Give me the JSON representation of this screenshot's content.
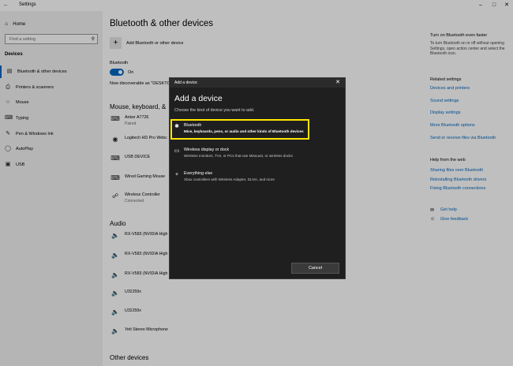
{
  "window": {
    "title": "Settings",
    "back_icon": "back-arrow-icon",
    "controls": [
      "minimize-icon",
      "maximize-icon",
      "close-icon"
    ]
  },
  "sidebar": {
    "home": "Home",
    "search_placeholder": "Find a setting",
    "section": "Devices",
    "items": [
      {
        "label": "Bluetooth & other devices",
        "icon": "bluetooth-devices-icon"
      },
      {
        "label": "Printers & scanners",
        "icon": "printer-icon"
      },
      {
        "label": "Mouse",
        "icon": "mouse-icon"
      },
      {
        "label": "Typing",
        "icon": "keyboard-icon"
      },
      {
        "label": "Pen & Windows Ink",
        "icon": "pen-icon"
      },
      {
        "label": "AutoPlay",
        "icon": "autoplay-icon"
      },
      {
        "label": "USB",
        "icon": "usb-icon"
      }
    ]
  },
  "main": {
    "title": "Bluetooth & other devices",
    "add_device": "Add Bluetooth or other device",
    "bluetooth_label": "Bluetooth",
    "toggle_state": "On",
    "discoverable": "Now discoverable as \"DESKTO",
    "section_mkp": "Mouse, keyboard, &",
    "devices": [
      {
        "name": "Anker A7726",
        "sub": "Paired",
        "icon": "keyboard-icon"
      },
      {
        "name": "Logitech HD Pro Webc",
        "sub": "",
        "icon": "webcam-icon"
      },
      {
        "name": "USB DEVICE",
        "sub": "",
        "icon": "keyboard-icon"
      },
      {
        "name": "Wired Gaming Mouse",
        "sub": "",
        "icon": "keyboard-icon"
      },
      {
        "name": "Wireless Controller",
        "sub": "Connected",
        "icon": "gamepad-icon"
      }
    ],
    "section_audio": "Audio",
    "audio": [
      {
        "name": "RX-V583 (NVIDIA High",
        "icon": "speaker-icon"
      },
      {
        "name": "RX-V583 (NVIDIA High",
        "icon": "speaker-icon"
      },
      {
        "name": "RX-V583 (NVIDIA High",
        "icon": "speaker-icon"
      },
      {
        "name": "U32J59x",
        "icon": "speaker-icon"
      },
      {
        "name": "U32J59x",
        "icon": "speaker-icon"
      },
      {
        "name": "Yeti Stereo Microphone",
        "icon": "speaker-icon"
      }
    ],
    "section_other": "Other devices"
  },
  "right": {
    "swift_title": "Turn on Bluetooth even faster",
    "swift_text": "To turn Bluetooth on or off without opening Settings, open action center and select the Bluetooth icon.",
    "related_title": "Related settings",
    "related_links": [
      "Devices and printers",
      "Sound settings",
      "Display settings",
      "More Bluetooth options",
      "Send or receive files via Bluetooth"
    ],
    "help_title": "Help from the web",
    "help_links": [
      "Sharing files over Bluetooth",
      "Reinstalling Bluetooth drivers",
      "Fixing Bluetooth connections"
    ],
    "get_help": "Get help",
    "give_feedback": "Give feedback"
  },
  "dialog": {
    "caption": "Add a device",
    "heading": "Add a device",
    "subheading": "Choose the kind of device you want to add.",
    "options": [
      {
        "title": "Bluetooth",
        "desc": "Mice, keyboards, pens, or audio and other kinds of Bluetooth devices",
        "icon": "bluetooth-icon"
      },
      {
        "title": "Wireless display or dock",
        "desc": "Wireless monitors, TVs, or PCs that use Miracast, or wireless docks",
        "icon": "monitor-icon"
      },
      {
        "title": "Everything else",
        "desc": "Xbox controllers with Wireless Adapter, DLNA, and more",
        "icon": "plus-icon"
      }
    ],
    "cancel": "Cancel",
    "highlight_color": "#ffe600"
  },
  "colors": {
    "accent": "#0067c0",
    "dialog_bg": "#1f1f1f"
  }
}
